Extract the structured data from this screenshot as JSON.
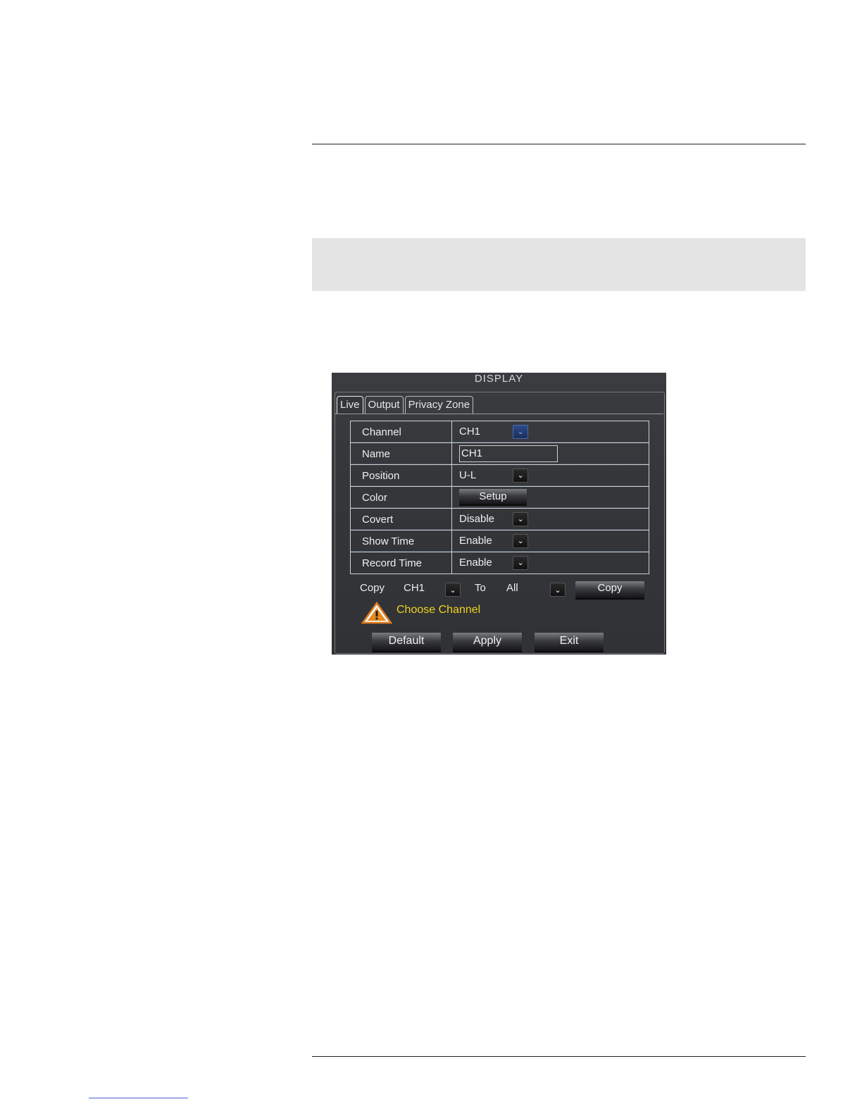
{
  "dialog": {
    "title": "DISPLAY",
    "tabs": [
      {
        "label": "Live"
      },
      {
        "label": "Output"
      },
      {
        "label": "Privacy Zone"
      }
    ],
    "rows": [
      {
        "label": "Channel",
        "value": "CH1"
      },
      {
        "label": "Name",
        "value": "CH1"
      },
      {
        "label": "Position",
        "value": "U-L"
      },
      {
        "label": "Color",
        "button": "Setup"
      },
      {
        "label": "Covert",
        "value": "Disable"
      },
      {
        "label": "Show Time",
        "value": "Enable"
      },
      {
        "label": "Record Time",
        "value": "Enable"
      }
    ],
    "copy": {
      "label": "Copy",
      "from": "CH1",
      "to_label": "To",
      "to": "All",
      "button": "Copy"
    },
    "message": "Choose Channel",
    "buttons": {
      "default": "Default",
      "apply": "Apply",
      "exit": "Exit"
    }
  },
  "colors": {
    "dialog_bg": "#34363a",
    "warning_text": "#f0d21e",
    "warning_icon": "#e07a1a"
  },
  "icons": {
    "dropdown": "chevron-down-icon",
    "warning": "warning-triangle-icon"
  }
}
